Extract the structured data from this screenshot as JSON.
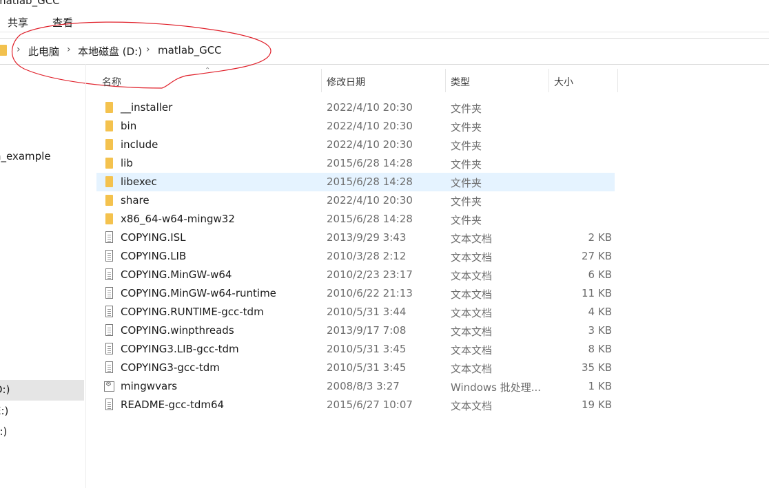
{
  "window": {
    "title": "matlab_GCC"
  },
  "ribbon": {
    "tabs": [
      "共享",
      "查看"
    ]
  },
  "address": {
    "crumbs": [
      "此电脑",
      "本地磁盘 (D:)",
      "matlab_GCC"
    ],
    "separator": "›"
  },
  "nav": {
    "items": [
      "n_example",
      "D:)",
      "E:)",
      "F:)"
    ]
  },
  "columns": {
    "name": "名称",
    "date": "修改日期",
    "type": "类型",
    "size": "大小"
  },
  "files": [
    {
      "name": "__installer",
      "date": "2022/4/10 20:30",
      "type": "文件夹",
      "size": "",
      "icon": "folder-icon"
    },
    {
      "name": "bin",
      "date": "2022/4/10 20:30",
      "type": "文件夹",
      "size": "",
      "icon": "folder-icon"
    },
    {
      "name": "include",
      "date": "2022/4/10 20:30",
      "type": "文件夹",
      "size": "",
      "icon": "folder-icon"
    },
    {
      "name": "lib",
      "date": "2015/6/28 14:28",
      "type": "文件夹",
      "size": "",
      "icon": "folder-icon"
    },
    {
      "name": "libexec",
      "date": "2015/6/28 14:28",
      "type": "文件夹",
      "size": "",
      "icon": "folder-icon"
    },
    {
      "name": "share",
      "date": "2022/4/10 20:30",
      "type": "文件夹",
      "size": "",
      "icon": "folder-icon"
    },
    {
      "name": "x86_64-w64-mingw32",
      "date": "2015/6/28 14:28",
      "type": "文件夹",
      "size": "",
      "icon": "folder-icon"
    },
    {
      "name": "COPYING.ISL",
      "date": "2013/9/29 3:43",
      "type": "文本文档",
      "size": "2 KB",
      "icon": "text-file-icon"
    },
    {
      "name": "COPYING.LIB",
      "date": "2010/3/28 2:12",
      "type": "文本文档",
      "size": "27 KB",
      "icon": "text-file-icon"
    },
    {
      "name": "COPYING.MinGW-w64",
      "date": "2010/2/23 23:17",
      "type": "文本文档",
      "size": "6 KB",
      "icon": "text-file-icon"
    },
    {
      "name": "COPYING.MinGW-w64-runtime",
      "date": "2010/6/22 21:13",
      "type": "文本文档",
      "size": "11 KB",
      "icon": "text-file-icon"
    },
    {
      "name": "COPYING.RUNTIME-gcc-tdm",
      "date": "2010/5/31 3:44",
      "type": "文本文档",
      "size": "4 KB",
      "icon": "text-file-icon"
    },
    {
      "name": "COPYING.winpthreads",
      "date": "2013/9/17 7:08",
      "type": "文本文档",
      "size": "3 KB",
      "icon": "text-file-icon"
    },
    {
      "name": "COPYING3.LIB-gcc-tdm",
      "date": "2010/5/31 3:45",
      "type": "文本文档",
      "size": "8 KB",
      "icon": "text-file-icon"
    },
    {
      "name": "COPYING3-gcc-tdm",
      "date": "2010/5/31 3:45",
      "type": "文本文档",
      "size": "35 KB",
      "icon": "text-file-icon"
    },
    {
      "name": "mingwvars",
      "date": "2008/8/3 3:27",
      "type": "Windows 批处理...",
      "size": "1 KB",
      "icon": "batch-file-icon"
    },
    {
      "name": "README-gcc-tdm64",
      "date": "2015/6/27 10:07",
      "type": "文本文档",
      "size": "19 KB",
      "icon": "text-file-icon"
    }
  ],
  "colors": {
    "hover_row": "#e5f3ff",
    "annotation_red": "#e0202a",
    "folder": "#f4c24e"
  }
}
